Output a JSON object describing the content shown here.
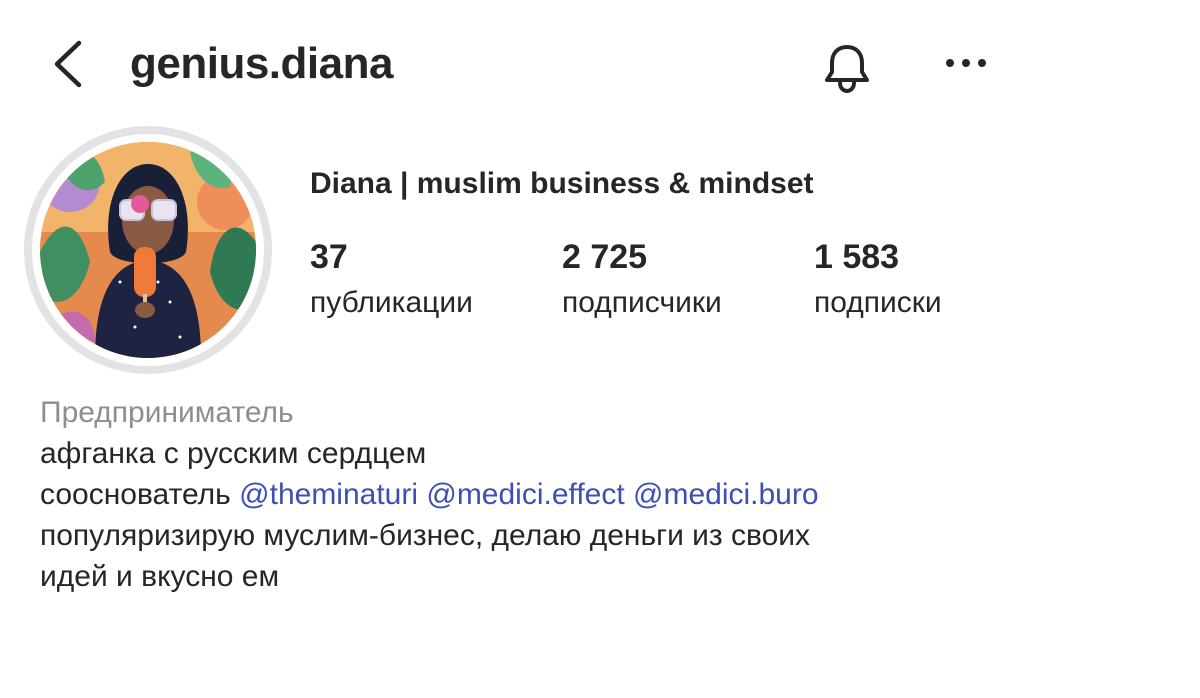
{
  "header": {
    "username": "genius.diana"
  },
  "profile": {
    "full_name": "Diana | muslim business & mindset",
    "stats": [
      {
        "value": "37",
        "label": "публикации"
      },
      {
        "value": "2 725",
        "label": "подписчики"
      },
      {
        "value": "1 583",
        "label": "подписки"
      }
    ]
  },
  "bio": {
    "category": "Предприниматель",
    "line1": "афганка с русским сердцем",
    "line2_prefix": "сооснователь",
    "mentions": [
      "@theminaturi",
      "@medici.effect",
      "@medici.buro"
    ],
    "line3": "популяризирую муслим-бизнес, делаю деньги из своих",
    "line4": "идей и вкусно ем"
  },
  "colors": {
    "text": "#262626",
    "secondary": "#8e8e8e",
    "link": "#3b4fb5",
    "avatar_ring": "#e3e3e6"
  }
}
